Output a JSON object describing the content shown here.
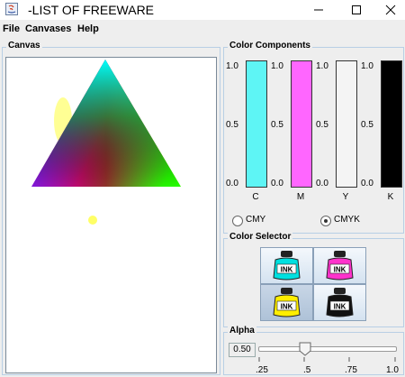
{
  "window": {
    "title": "-LIST OF FREEWARE"
  },
  "menu": {
    "file": "File",
    "canvases": "Canvases",
    "help": "Help"
  },
  "canvas_panel": {
    "legend": "Canvas"
  },
  "components": {
    "legend": "Color Components",
    "scale": {
      "top": "1.0",
      "mid": "0.5",
      "bottom": "0.0"
    },
    "bars": [
      {
        "label": "C",
        "value": 1.0,
        "color": "#5ef5f5"
      },
      {
        "label": "M",
        "value": 1.0,
        "color": "#ff66ff"
      },
      {
        "label": "Y",
        "value": 0.0,
        "color": "#ffff00"
      },
      {
        "label": "K",
        "value": 1.0,
        "color": "#000000"
      }
    ],
    "modes": [
      {
        "label": "CMY",
        "selected": false
      },
      {
        "label": "CMYK",
        "selected": true
      }
    ]
  },
  "selector": {
    "legend": "Color Selector",
    "inks": [
      {
        "name": "cyan-ink",
        "color": "#00e0e0",
        "pressed": false
      },
      {
        "name": "magenta-ink",
        "color": "#ff33cc",
        "pressed": false
      },
      {
        "name": "yellow-ink",
        "color": "#ffee00",
        "pressed": true
      },
      {
        "name": "black-ink",
        "color": "#111111",
        "pressed": false
      }
    ],
    "ink_label": "INK"
  },
  "alpha": {
    "legend": "Alpha",
    "value": "0.50",
    "slider_fraction": 0.5,
    "ticks": [
      ".25",
      ".5",
      ".75",
      "1.0"
    ]
  }
}
